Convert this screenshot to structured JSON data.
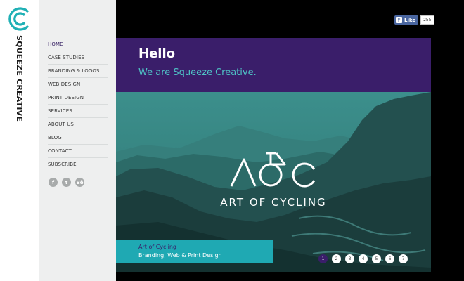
{
  "brand": {
    "name": "SQUEEZE CREATIVE",
    "logo_icon": "squeeze-logo-icon",
    "accent": "#1fb0b5",
    "purple": "#3a1e6a"
  },
  "nav": {
    "items": [
      {
        "label": "HOME",
        "active": true
      },
      {
        "label": "CASE STUDIES"
      },
      {
        "label": "BRANDING & LOGOS"
      },
      {
        "label": "WEB DESIGN"
      },
      {
        "label": "PRINT DESIGN"
      },
      {
        "label": "SERVICES"
      },
      {
        "label": "ABOUT US"
      },
      {
        "label": "BLOG"
      },
      {
        "label": "CONTACT"
      },
      {
        "label": "SUBSCRIBE"
      }
    ],
    "social": [
      {
        "icon": "facebook-icon",
        "glyph": "f"
      },
      {
        "icon": "twitter-icon",
        "glyph": "t"
      },
      {
        "icon": "behance-icon",
        "glyph": "Bē"
      }
    ]
  },
  "facebook": {
    "like_label": "Like",
    "count": "255"
  },
  "hello": {
    "title": "Hello",
    "subtitle": "We are Squeeze Creative."
  },
  "hero": {
    "mark": "AOC",
    "title": "ART OF CYCLING",
    "caption_title": "Art of Cycling",
    "caption_subtitle": "Branding, Web & Print Design"
  },
  "pager": {
    "pages": [
      "1",
      "2",
      "3",
      "4",
      "5",
      "6",
      "7"
    ],
    "current": "1"
  }
}
